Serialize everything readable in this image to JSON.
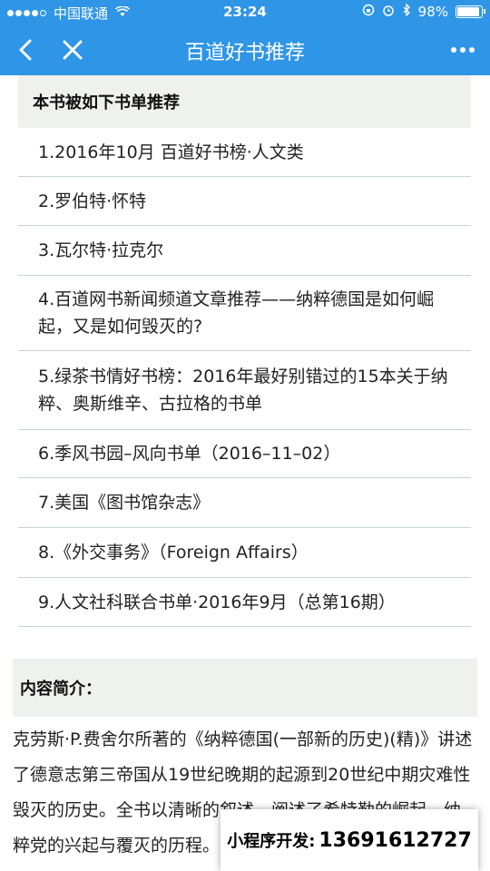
{
  "status_bar": {
    "carrier": "中国联通",
    "time": "23:24",
    "battery": "98%",
    "battery_level": 0.98
  },
  "nav": {
    "title": "百道好书推荐",
    "back_icon": "chevron-left-icon",
    "close_icon": "close-icon",
    "more_icon": "more-dots-icon"
  },
  "recommend_section": {
    "header": "本书被如下书单推荐",
    "items": [
      "1.2016年10月 百道好书榜·人文类",
      "2.罗伯特·怀特",
      "3.瓦尔特·拉克尔",
      "4.百道网书新闻频道文章推荐——纳粹德国是如何崛起，又是如何毁灭的?",
      "5.绿茶书情好书榜：2016年最好别错过的15本关于纳粹、奥斯维辛、古拉格的书单",
      "6.季风书园–风向书单（2016–11–02）",
      "7.美国《图书馆杂志》",
      "8.《外交事务》（Foreign Affairs）",
      "9.人文社科联合书单·2016年9月（总第16期）"
    ]
  },
  "intro_section": {
    "header": "内容简介：",
    "text": "克劳斯·P.费舍尔所著的《纳粹德国(一部新的历史)(精)》讲述了德意志第三帝国从19世纪晚期的起源到20世纪中期灾难性毁灭的历史。全书以清晰的叙述，阐述了希特勒的崛起、纳粹党的兴起与覆灭的历程。"
  },
  "dev_banner": {
    "label": "小程序开发:",
    "phone": "13691612727"
  },
  "colors": {
    "nav_background": "#2f95e6",
    "section_header_background": "#eef1ec",
    "divider": "#c8d2d8"
  }
}
